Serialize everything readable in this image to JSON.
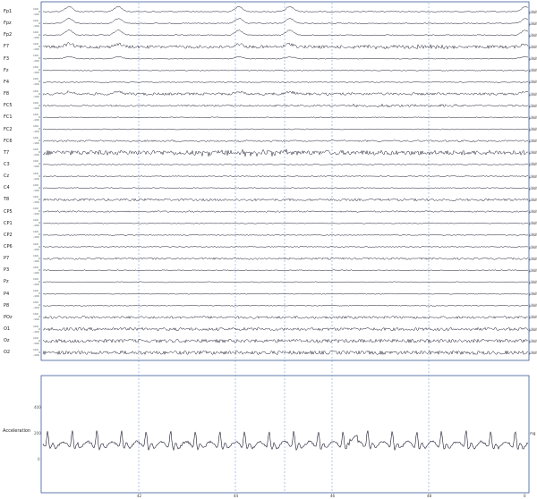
{
  "eeg": {
    "channels": [
      "Fp1",
      "Fpz",
      "Fp2",
      "F7",
      "F3",
      "Fz",
      "F4",
      "F8",
      "FC5",
      "FC1",
      "FC2",
      "FC6",
      "T7",
      "C3",
      "Cz",
      "C4",
      "T8",
      "CP5",
      "CP1",
      "CP2",
      "CP6",
      "P7",
      "P3",
      "Pz",
      "P4",
      "P8",
      "POz",
      "O1",
      "Oz",
      "O2"
    ],
    "scale_top": "100",
    "scale_zero": "0",
    "scale_bottom": "-100",
    "unit": "µVolt",
    "colors": {
      "trace": "#1a1a2e",
      "frame": "#3a5a9a",
      "gridline": "#5b8fd6"
    }
  },
  "accel": {
    "label": "Acceleration",
    "ticks": [
      "400",
      "200",
      "0"
    ],
    "unit": "mg"
  },
  "time_axis": {
    "ticks": [
      "42",
      "44",
      "46",
      "48",
      "0"
    ]
  }
}
